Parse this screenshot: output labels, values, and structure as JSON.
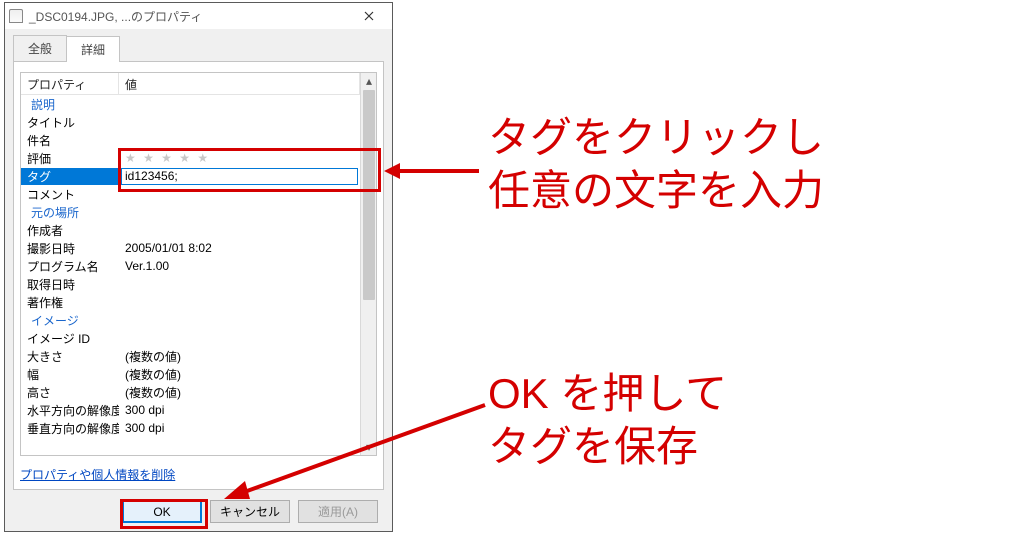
{
  "titlebar": {
    "title": "_DSC0194.JPG, ...のプロパティ"
  },
  "tabs": {
    "general": "全般",
    "details": "詳細"
  },
  "columns": {
    "property": "プロパティ",
    "value": "値"
  },
  "sections": {
    "description": "説明",
    "origin": "元の場所",
    "image": "イメージ"
  },
  "rows": {
    "title": {
      "label": "タイトル",
      "value": ""
    },
    "subject": {
      "label": "件名",
      "value": ""
    },
    "rating": {
      "label": "評価",
      "value": "★ ★ ★ ★ ★"
    },
    "tags": {
      "label": "タグ",
      "value": "id123456;"
    },
    "comment": {
      "label": "コメント",
      "value": ""
    },
    "author": {
      "label": "作成者",
      "value": ""
    },
    "date_taken": {
      "label": "撮影日時",
      "value": "2005/01/01 8:02"
    },
    "program": {
      "label": "プログラム名",
      "value": "Ver.1.00"
    },
    "date_acq": {
      "label": "取得日時",
      "value": ""
    },
    "copyright": {
      "label": "著作権",
      "value": ""
    },
    "image_id": {
      "label": "イメージ ID",
      "value": ""
    },
    "dimensions": {
      "label": "大きさ",
      "value": "(複数の値)"
    },
    "width": {
      "label": "幅",
      "value": "(複数の値)"
    },
    "height": {
      "label": "高さ",
      "value": "(複数の値)"
    },
    "hres": {
      "label": "水平方向の解像度",
      "value": "300 dpi"
    },
    "vres": {
      "label": "垂直方向の解像度",
      "value": "300 dpi"
    }
  },
  "remove_link": "プロパティや個人情報を削除",
  "buttons": {
    "ok": "OK",
    "cancel": "キャンセル",
    "apply": "適用(A)"
  },
  "annotations": {
    "tag_note": "タグをクリックし\n任意の文字を入力",
    "ok_note": "OK を押して\nタグを保存"
  }
}
